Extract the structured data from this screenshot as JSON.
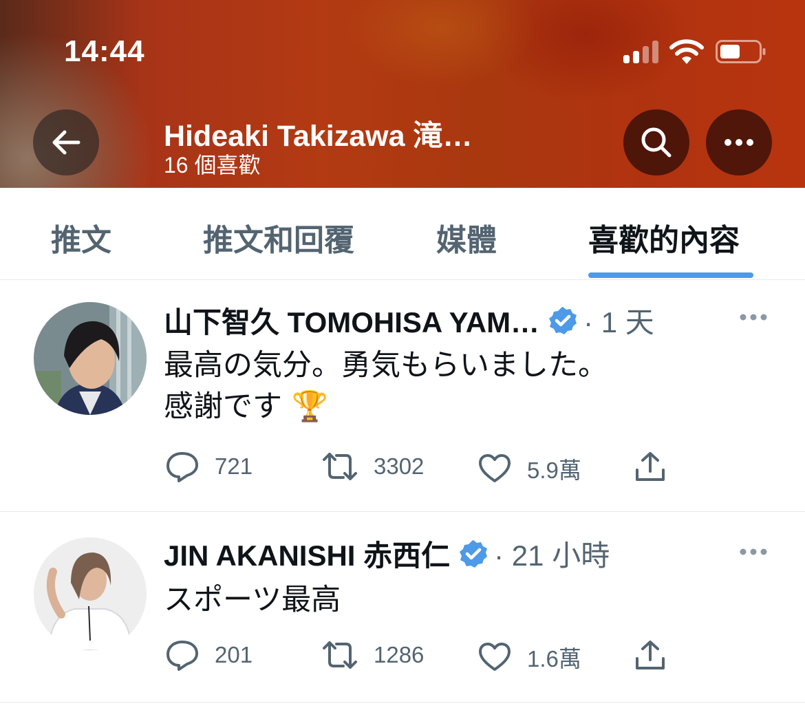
{
  "status_bar": {
    "time": "14:44"
  },
  "header": {
    "profile_name": "Hideaki Takizawa 滝…",
    "likes_count": "16 個喜歡",
    "background_color": "#b3360f"
  },
  "tabs": [
    {
      "label": "推文",
      "active": false
    },
    {
      "label": "推文和回覆",
      "active": false
    },
    {
      "label": "媒體",
      "active": false
    },
    {
      "label": "喜歡的內容",
      "active": true
    }
  ],
  "accent_color": "#4d9ae8",
  "tweets": [
    {
      "author": "山下智久 TOMOHISA YAM…",
      "verified": true,
      "time": "· 1 天",
      "text": "最高の気分。勇気もらいました。\n感謝です",
      "emoji": "🏆",
      "replies": "721",
      "retweets": "3302",
      "likes": "5.9萬"
    },
    {
      "author": "JIN AKANISHI 赤西仁",
      "verified": true,
      "time": "· 21 小時",
      "text": "スポーツ最高",
      "replies": "201",
      "retweets": "1286",
      "likes": "1.6萬"
    }
  ]
}
